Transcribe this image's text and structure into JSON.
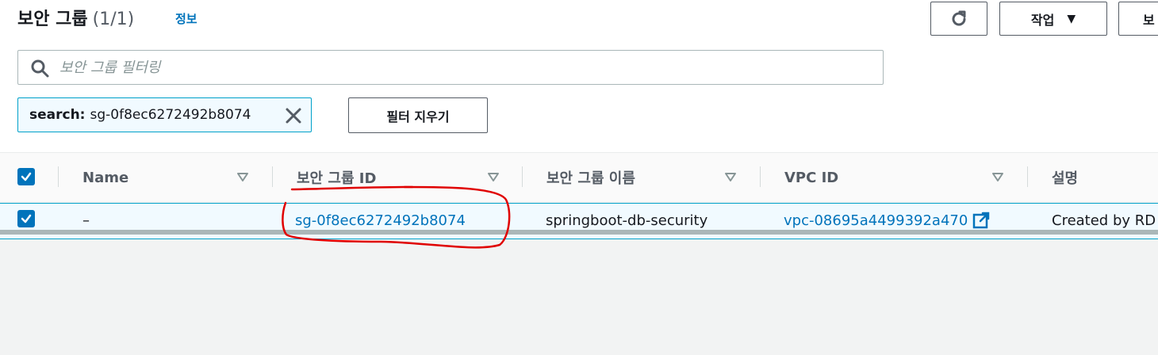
{
  "header": {
    "title": "보안 그룹",
    "count": "(1/1)",
    "info_link": "정보",
    "actions_label": "작업",
    "extra_button_label": "보"
  },
  "search": {
    "placeholder": "보안 그룹 필터링",
    "value": ""
  },
  "filter_token": {
    "key": "search:",
    "value": "sg-0f8ec6272492b8074"
  },
  "clear_filters_label": "필터 지우기",
  "columns": [
    "Name",
    "보안 그룹 ID",
    "보안 그룹 이름",
    "VPC ID",
    "설명"
  ],
  "rows": [
    {
      "selected": true,
      "name": "–",
      "group_id": "sg-0f8ec6272492b8074",
      "group_name": "springboot-db-security",
      "vpc_id": "vpc-08695a4499392a470",
      "description": "Created by RD"
    }
  ],
  "colors": {
    "accent": "#0073bb",
    "annotation": "#e00000"
  },
  "icons": [
    "refresh-icon",
    "caret-down-icon",
    "search-icon",
    "close-icon",
    "sort-icon",
    "checkbox-checked-icon",
    "external-link-icon"
  ]
}
